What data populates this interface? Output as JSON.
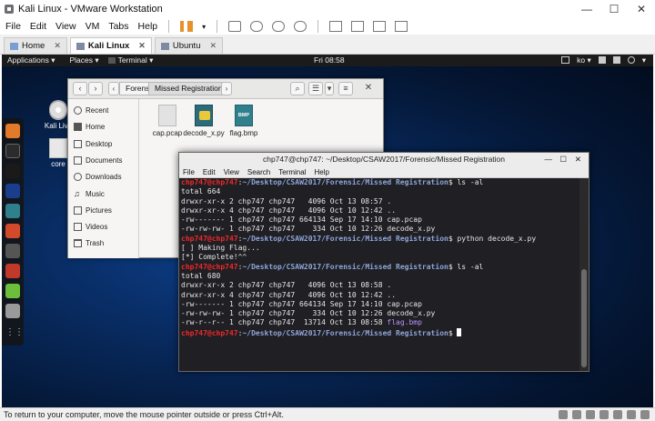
{
  "vmware": {
    "title": "Kali Linux - VMware Workstation",
    "menu": [
      "File",
      "Edit",
      "View",
      "VM",
      "Tabs",
      "Help"
    ],
    "tabs": [
      {
        "label": "Home",
        "active": false
      },
      {
        "label": "Kali Linux",
        "active": true
      },
      {
        "label": "Ubuntu",
        "active": false
      }
    ],
    "status": "To return to your computer, move the mouse pointer outside or press Ctrl+Alt."
  },
  "gnome": {
    "applications": "Applications ▾",
    "places": "Places ▾",
    "terminal": "Terminal ▾",
    "clock": "Fri 08:58",
    "keyboard": "ko ▾"
  },
  "desktop": {
    "icons": [
      {
        "label": "Kali Live"
      },
      {
        "label": "core"
      }
    ]
  },
  "files": {
    "breadcrumbs": [
      "Forensic",
      "Missed Registration"
    ],
    "sidebar": [
      "Recent",
      "Home",
      "Desktop",
      "Documents",
      "Downloads",
      "Music",
      "Pictures",
      "Videos",
      "Trash"
    ],
    "items": [
      {
        "name": "cap.pcap",
        "type": "generic"
      },
      {
        "name": "decode_x.py",
        "type": "python"
      },
      {
        "name": "flag.bmp",
        "type": "bmp",
        "badge": "BMP"
      }
    ]
  },
  "terminal": {
    "title": "chp747@chp747: ~/Desktop/CSAW2017/Forensic/Missed Registration",
    "menu": [
      "File",
      "Edit",
      "View",
      "Search",
      "Terminal",
      "Help"
    ],
    "user": "chp747@chp747",
    "path": "~/Desktop/CSAW2017/Forensic/Missed Registration",
    "cmd1": "ls -al",
    "total1": "total 664",
    "ls1": [
      "drwxr-xr-x 2 chp747 chp747   4096 Oct 13 08:57 .",
      "drwxr-xr-x 4 chp747 chp747   4096 Oct 10 12:42 ..",
      "-rw------- 1 chp747 chp747 664134 Sep 17 14:10 cap.pcap",
      "-rw-rw-rw- 1 chp747 chp747    334 Oct 10 12:26 decode_x.py"
    ],
    "cmd2": "python decode_x.py",
    "out2": [
      "[ ] Making Flag...",
      "[*] Complete!^^"
    ],
    "cmd3": "ls -al",
    "total3": "total 680",
    "ls3": [
      "drwxr-xr-x 2 chp747 chp747   4096 Oct 13 08:58 .",
      "drwxr-xr-x 4 chp747 chp747   4096 Oct 10 12:42 ..",
      "-rw------- 1 chp747 chp747 664134 Sep 17 14:10 cap.pcap",
      "-rw-rw-rw- 1 chp747 chp747    334 Oct 10 12:26 decode_x.py"
    ],
    "ls3_last_prefix": "-rw-r--r-- 1 chp747 chp747  13714 Oct 13 08:58 ",
    "ls3_last_name": "flag.bmp"
  }
}
